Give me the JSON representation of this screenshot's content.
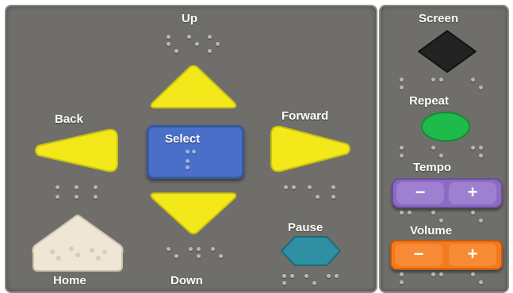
{
  "labels": {
    "up": "Up",
    "back": "Back",
    "forward": "Forward",
    "down": "Down",
    "home": "Home",
    "pause": "Pause",
    "select": "Select",
    "screen": "Screen",
    "repeat": "Repeat",
    "tempo": "Tempo",
    "volume": "Volume"
  },
  "symbols": {
    "minus": "−",
    "plus": "+"
  },
  "colors": {
    "panel": "#6f6e6b",
    "arrow_yellow": "#f2e81a",
    "select_blue": "#4a6fc9",
    "home_cream": "#efe6d6",
    "pause_teal": "#2f8fa3",
    "screen_black": "#222222",
    "repeat_green": "#1fbb4a",
    "tempo_purple": "#8d6bc4",
    "volume_orange": "#f47a1f"
  },
  "icons": {
    "up": "triangle-up-icon",
    "down": "triangle-down-icon",
    "back": "triangle-left-icon",
    "forward": "triangle-right-icon",
    "home": "pentagon-icon",
    "pause": "hexagon-icon",
    "screen": "diamond-icon",
    "repeat": "circle-icon"
  }
}
